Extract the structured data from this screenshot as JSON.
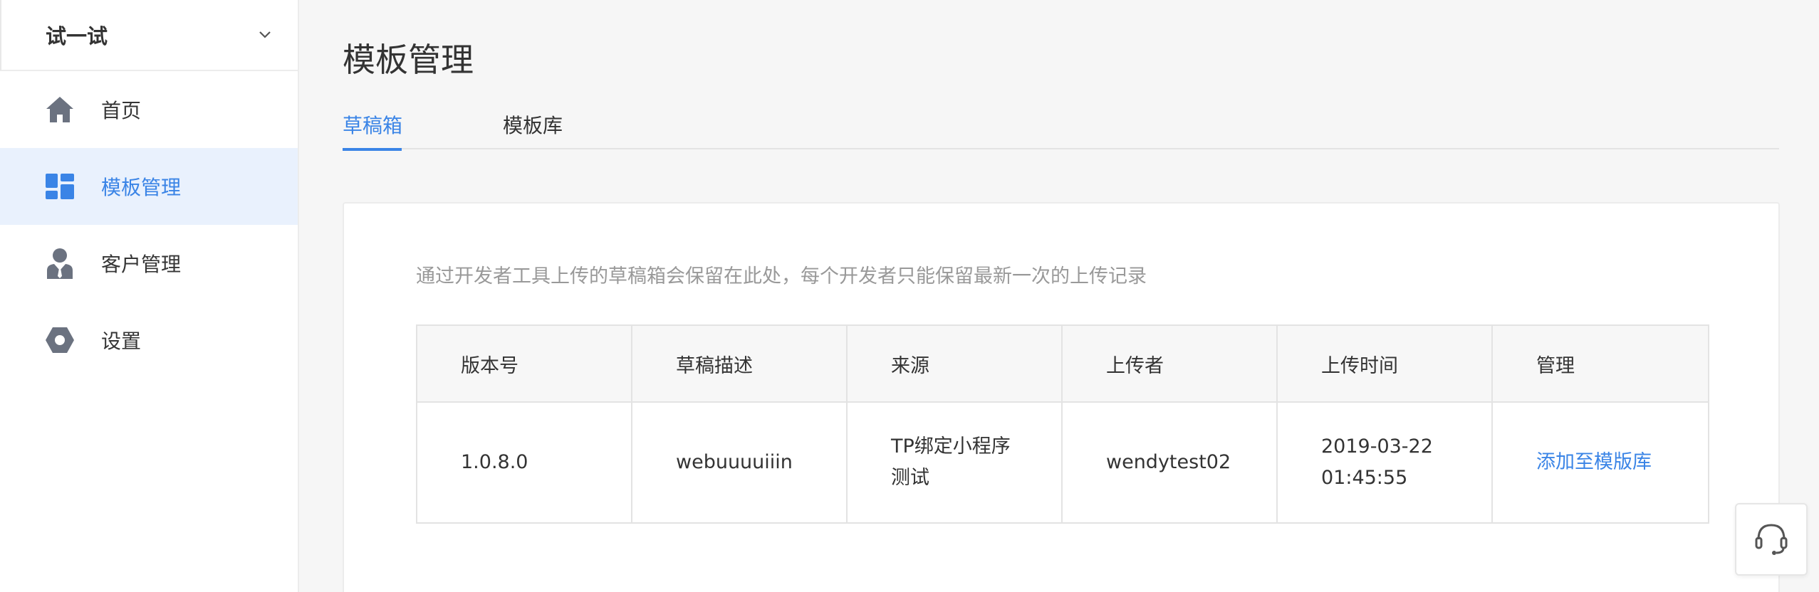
{
  "sidebar": {
    "app_name": "试一试",
    "items": [
      {
        "label": "首页",
        "icon": "home-icon"
      },
      {
        "label": "模板管理",
        "icon": "dashboard-icon",
        "active": true
      },
      {
        "label": "客户管理",
        "icon": "user-icon"
      },
      {
        "label": "设置",
        "icon": "settings-icon"
      }
    ]
  },
  "main": {
    "title": "模板管理",
    "tabs": [
      {
        "label": "草稿箱",
        "active": true
      },
      {
        "label": "模板库",
        "active": false
      }
    ],
    "hint": "通过开发者工具上传的草稿箱会保留在此处，每个开发者只能保留最新一次的上传记录",
    "table": {
      "headers": [
        "版本号",
        "草稿描述",
        "来源",
        "上传者",
        "上传时间",
        "管理"
      ],
      "rows": [
        {
          "version": "1.0.8.0",
          "description": "webuuuuiiin",
          "source_line1": "TP绑定小程序",
          "source_line2": "测试",
          "uploader": "wendytest02",
          "time_line1": "2019-03-22",
          "time_line2": "01:45:55",
          "action": "添加至模版库"
        }
      ]
    }
  },
  "colors": {
    "accent": "#3a84e6",
    "active_bg": "#e9f1fd",
    "icon_gray": "#6b7280"
  },
  "support_button_icon": "headset-icon"
}
